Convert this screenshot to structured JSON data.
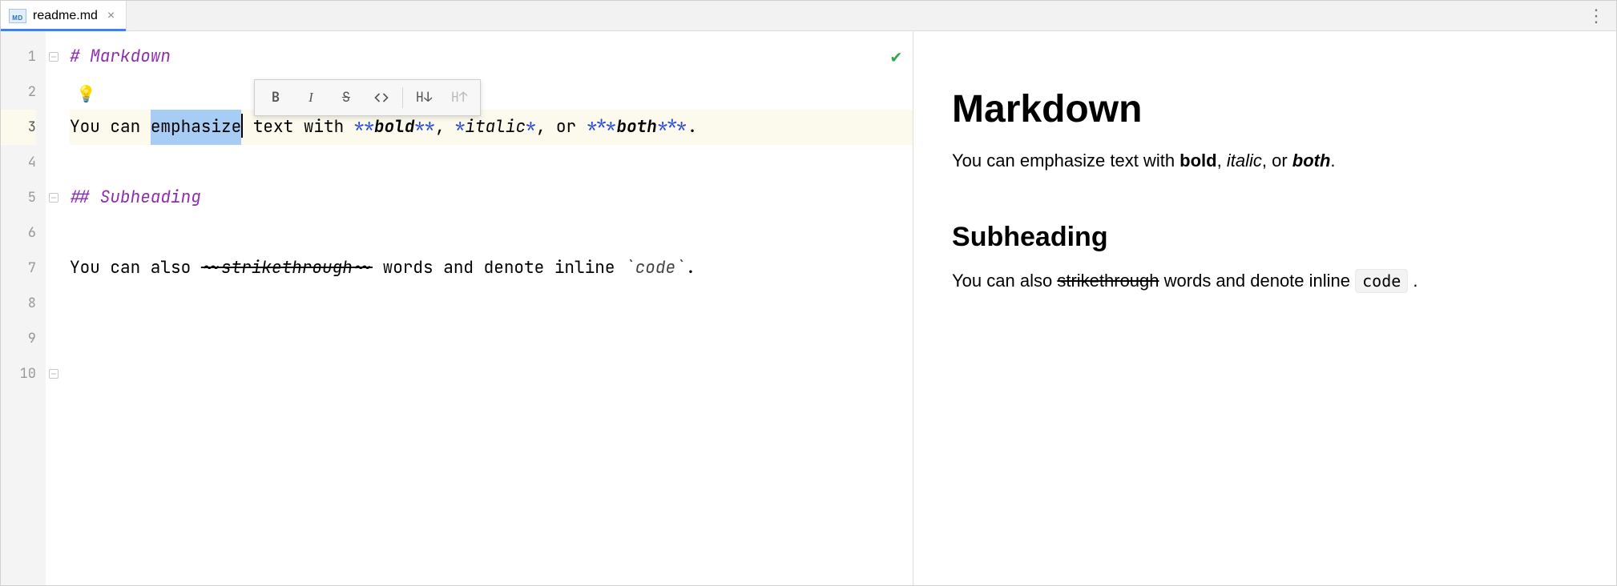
{
  "tab": {
    "filename": "readme.md",
    "icon_label": "MD",
    "close_glyph": "×",
    "kebab_glyph": "⋮"
  },
  "editor": {
    "line_numbers": [
      "1",
      "2",
      "3",
      "4",
      "5",
      "6",
      "7",
      "8",
      "9",
      "10"
    ],
    "highlighted_line_index": 2,
    "lines": {
      "l1": {
        "text": "# Markdown"
      },
      "l3": {
        "prefix": "You can ",
        "selected": "emphasize",
        "mid1": " text with ",
        "bold_delim": "**",
        "bold_text": "bold",
        "mid2": ", ",
        "ital_delim": "*",
        "ital_text": "italic",
        "mid3": ", or ",
        "both_delim": "***",
        "both_text": "both",
        "tail": "."
      },
      "l5": {
        "text": "## Subheading"
      },
      "l7": {
        "prefix": "You can also ",
        "strike_delim": "~~",
        "strike_text": "strikethrough",
        "mid": " words and denote inline ",
        "code_delim": "`",
        "code_text": "code",
        "tail": "."
      }
    },
    "bulb_glyph": "💡",
    "check_glyph": "✔",
    "floating_toolbar": {
      "bold_label": "B",
      "italic_label": "I",
      "strike_label": "S",
      "code_label": "<>",
      "h_down_label": "H↓",
      "h_up_label": "H↑"
    }
  },
  "preview": {
    "h1": "Markdown",
    "p1_a": "You can emphasize text with ",
    "p1_bold": "bold",
    "p1_b": ", ",
    "p1_italic": "italic",
    "p1_c": ", or ",
    "p1_both": "both",
    "p1_d": ".",
    "h2": "Subheading",
    "p2_a": "You can also ",
    "p2_strike": "strikethrough",
    "p2_b": " words and denote inline ",
    "p2_code": "code",
    "p2_c": " ."
  }
}
